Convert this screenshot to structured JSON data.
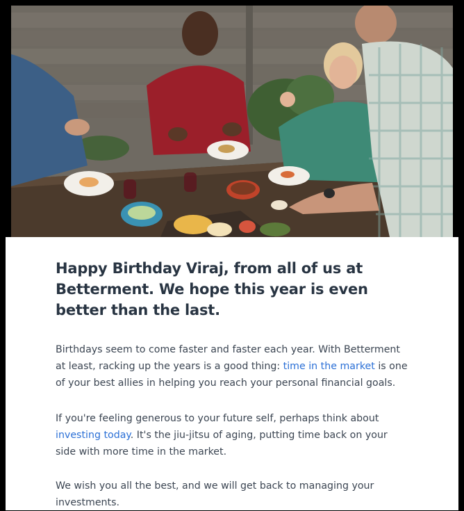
{
  "hero": {
    "image_label": "people-eating-at-outdoor-table-photo"
  },
  "headline": "Happy Birthday Viraj, from all of us at Betterment. We hope this year is even better than the last.",
  "paragraphs": {
    "p1": {
      "before": "Birthdays seem to come faster and faster each year. With Betterment at least, racking up the years is a good thing: ",
      "link": "time in the market",
      "after": " is one of your best allies in helping you reach your personal financial goals."
    },
    "p2": {
      "before": "If you're feeling generous to your future self, perhaps think about ",
      "link": "investing today",
      "after": ". It's the jiu-jitsu of aging, putting time back on your side with more time in the market."
    },
    "p3": {
      "text": "We wish you all the best, and we will get back to managing your investments."
    }
  },
  "colors": {
    "headline": "#283442",
    "body_text": "#3b4552",
    "link": "#2a6fd6",
    "background": "#ffffff",
    "frame": "#000000"
  }
}
